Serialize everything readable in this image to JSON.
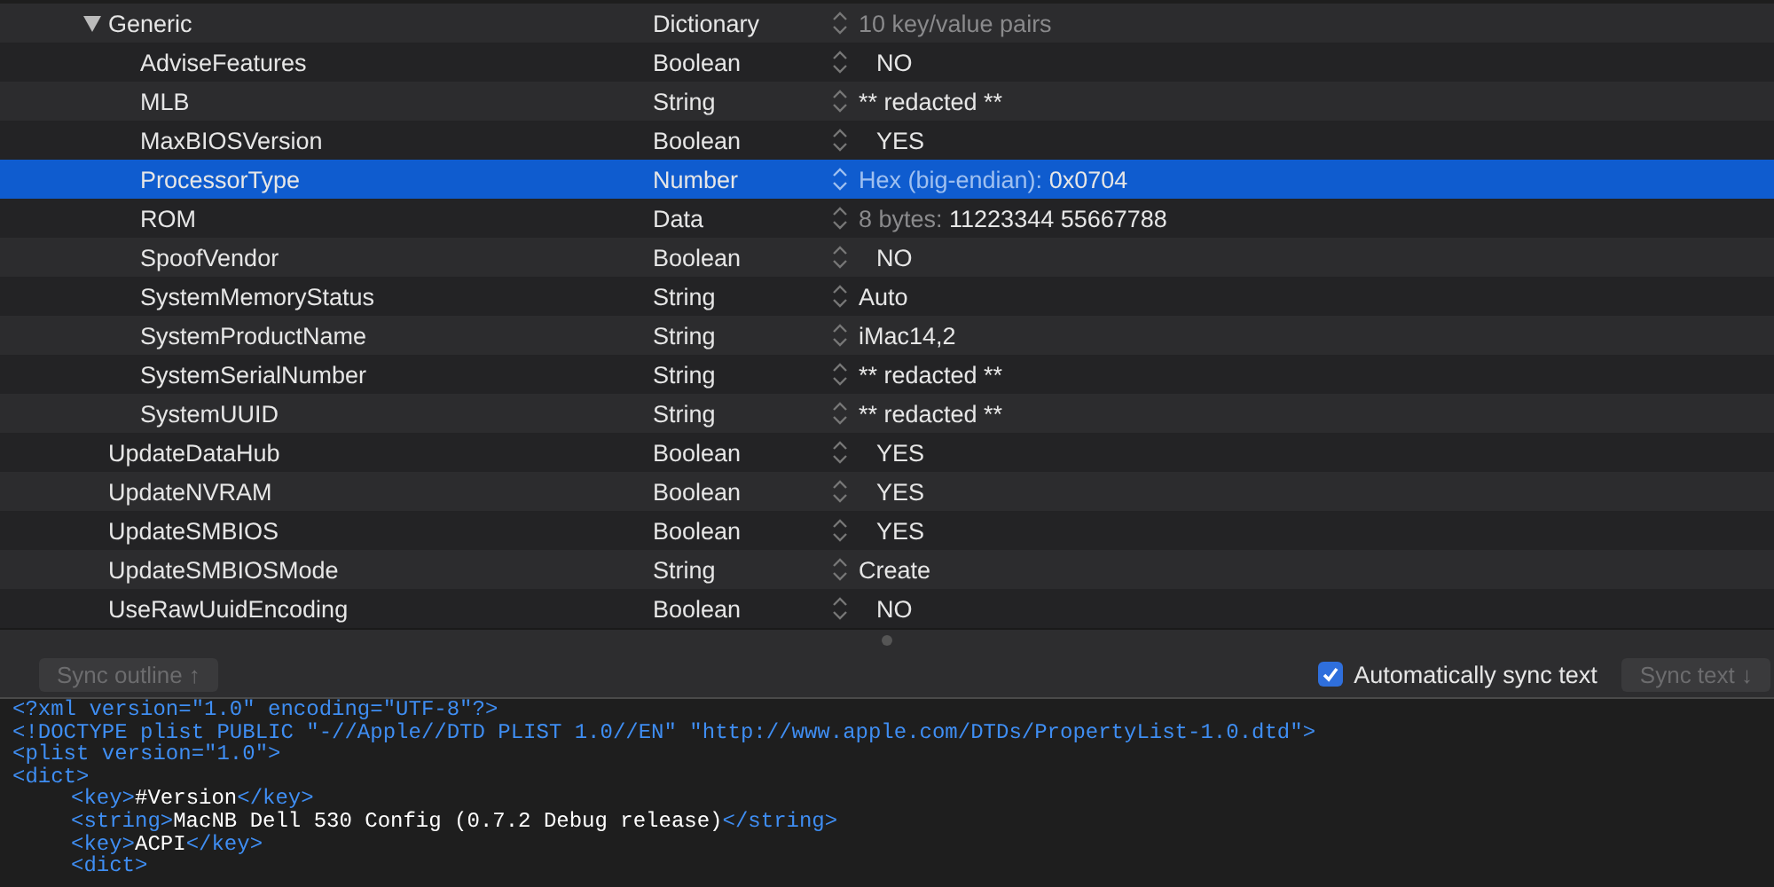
{
  "outline": {
    "rows": [
      {
        "key": "Generic",
        "type": "Dictionary",
        "value_hint": "10 key/value pairs",
        "expanded": true,
        "selected": false,
        "kind": "text",
        "children": [
          {
            "key": "AdviseFeatures",
            "type": "Boolean",
            "value": "NO",
            "kind": "boolean",
            "selected": false
          },
          {
            "key": "MLB",
            "type": "String",
            "value": "** redacted **",
            "kind": "text",
            "selected": false
          },
          {
            "key": "MaxBIOSVersion",
            "type": "Boolean",
            "value": "YES",
            "kind": "boolean",
            "selected": false
          },
          {
            "key": "ProcessorType",
            "type": "Number",
            "value_hint": "Hex (big-endian): ",
            "value": "0x0704",
            "kind": "text",
            "selected": true
          },
          {
            "key": "ROM",
            "type": "Data",
            "value_hint": "8 bytes: ",
            "value": "11223344 55667788",
            "kind": "text",
            "selected": false
          },
          {
            "key": "SpoofVendor",
            "type": "Boolean",
            "value": "NO",
            "kind": "boolean",
            "selected": false
          },
          {
            "key": "SystemMemoryStatus",
            "type": "String",
            "value": "Auto",
            "kind": "text",
            "selected": false
          },
          {
            "key": "SystemProductName",
            "type": "String",
            "value": "iMac14,2",
            "kind": "text",
            "selected": false
          },
          {
            "key": "SystemSerialNumber",
            "type": "String",
            "value": "** redacted **",
            "kind": "text",
            "selected": false
          },
          {
            "key": "SystemUUID",
            "type": "String",
            "value": "** redacted **",
            "kind": "text",
            "selected": false
          }
        ]
      },
      {
        "key": "UpdateDataHub",
        "type": "Boolean",
        "value": "YES",
        "kind": "boolean",
        "selected": false
      },
      {
        "key": "UpdateNVRAM",
        "type": "Boolean",
        "value": "YES",
        "kind": "boolean",
        "selected": false
      },
      {
        "key": "UpdateSMBIOS",
        "type": "Boolean",
        "value": "YES",
        "kind": "boolean",
        "selected": false
      },
      {
        "key": "UpdateSMBIOSMode",
        "type": "String",
        "value": "Create",
        "kind": "text",
        "selected": false
      },
      {
        "key": "UseRawUuidEncoding",
        "type": "Boolean",
        "value": "NO",
        "kind": "boolean",
        "selected": false
      }
    ]
  },
  "toolbar": {
    "sync_outline": {
      "label": "Sync outline ↑",
      "disabled": true
    },
    "auto_sync": {
      "label": "Automatically sync text",
      "checked": true
    },
    "sync_text": {
      "label": "Sync text ↓",
      "disabled": true
    }
  },
  "xml": {
    "lines": [
      {
        "segments": [
          {
            "kind": "tag",
            "text": "<?xml version=\"1.0\" encoding=\"UTF-8\"?>"
          }
        ]
      },
      {
        "segments": [
          {
            "kind": "tag",
            "text": "<!DOCTYPE plist PUBLIC \"-//Apple//DTD PLIST 1.0//EN\" \"http://www.apple.com/DTDs/PropertyList-1.0.dtd\">"
          }
        ]
      },
      {
        "segments": [
          {
            "kind": "tag",
            "text": "<plist version=\"1.0\">"
          }
        ]
      },
      {
        "segments": [
          {
            "kind": "tag",
            "text": "<dict>"
          }
        ],
        "children": [
          {
            "segments": [
              {
                "kind": "tag",
                "text": "<key>"
              },
              {
                "kind": "content",
                "text": "#Version"
              },
              {
                "kind": "tag",
                "text": "</key>"
              }
            ]
          },
          {
            "segments": [
              {
                "kind": "tag",
                "text": "<string>"
              },
              {
                "kind": "content",
                "text": "MacNB Dell 530 Config (0.7.2 Debug release)"
              },
              {
                "kind": "tag",
                "text": "</string>"
              }
            ]
          },
          {
            "segments": [
              {
                "kind": "tag",
                "text": "<key>"
              },
              {
                "kind": "content",
                "text": "ACPI"
              },
              {
                "kind": "tag",
                "text": "</key>"
              }
            ]
          },
          {
            "segments": [
              {
                "kind": "tag",
                "text": "<dict>"
              }
            ]
          }
        ]
      }
    ]
  }
}
